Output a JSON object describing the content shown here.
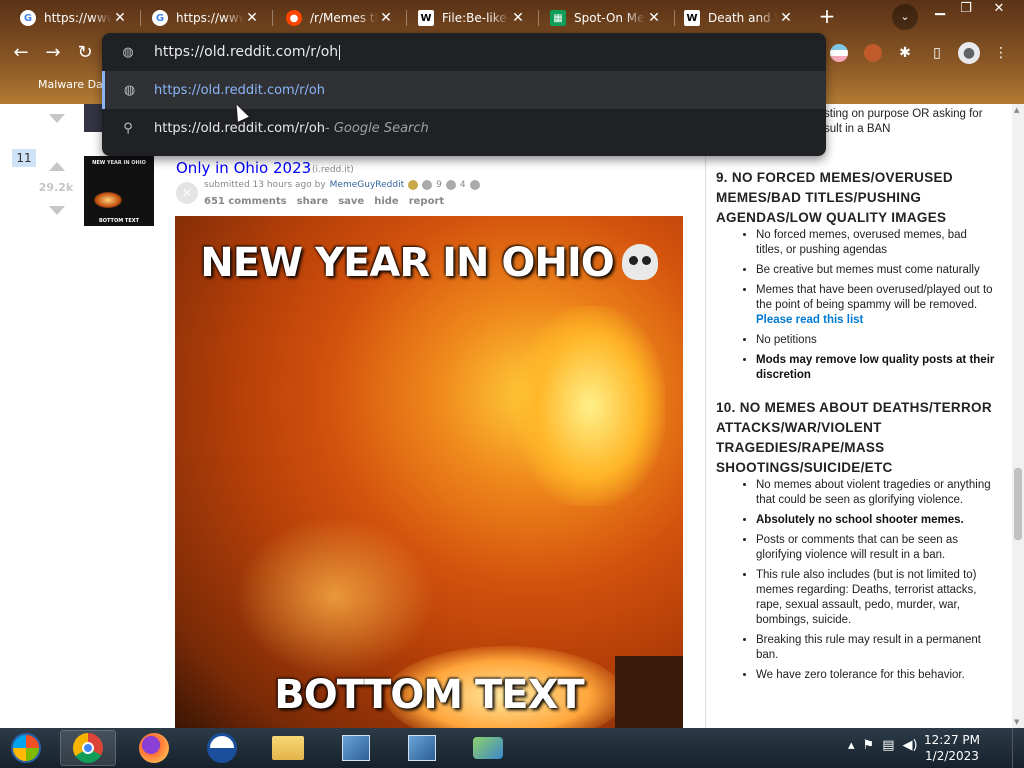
{
  "tabs": [
    {
      "title": "https://www",
      "icon": "google-icon",
      "color": "#4285f4"
    },
    {
      "title": "https://www",
      "icon": "google-icon",
      "color": "#4285f4"
    },
    {
      "title": "/r/Memes th",
      "icon": "reddit-icon",
      "color": "#ff4500"
    },
    {
      "title": "File:Be-like-",
      "icon": "wikipedia-icon",
      "color": "#ffffff"
    },
    {
      "title": "Spot-On Mer",
      "icon": "spreadsheet-icon",
      "color": "#0f9d58"
    },
    {
      "title": "Death and W",
      "icon": "wikipedia-icon",
      "color": "#ffffff"
    }
  ],
  "omnibox": {
    "input": "https://old.reddit.com/r/oh",
    "suggestions": [
      {
        "text": "https://old.reddit.com/r/oh",
        "sub": ""
      },
      {
        "text": "https://old.reddit.com/r/oh",
        "sub": " - Google Search"
      }
    ]
  },
  "bookmarks": {
    "first": "Malware Dat"
  },
  "post": {
    "rank": "11",
    "score": "29.2k",
    "title": "Only in Ohio 2023",
    "domain": "(i.redd.it)",
    "submitted": "submitted 13 hours ago by",
    "author": "MemeGuyReddit",
    "award_count_1": "9",
    "award_count_2": "4",
    "comments": "651 comments",
    "share": "share",
    "save": "save",
    "hide": "hide",
    "report": "report",
    "thumb_top": "NEW YEAR IN OHIO",
    "thumb_bottom": "BOTTOM TEXT",
    "caption_top": "NEW YEAR IN OHIO",
    "caption_bottom": "BOTTOM TEXT"
  },
  "sidebar": {
    "fragment": "sting on purpose OR asking for sult in a BAN",
    "rule9": {
      "heading": "9. NO FORCED MEMES/OVERUSED MEMES/BAD TITLES/PUSHING AGENDAS/LOW QUALITY IMAGES",
      "items": [
        "No forced memes, overused memes, bad titles, or pushing agendas",
        "Be creative but memes must come naturally",
        "Memes that have been overused/played out to the point of being spammy will be removed.",
        "No petitions",
        "Mods may remove low quality posts at their discretion"
      ],
      "link": "Please read this list"
    },
    "rule10": {
      "heading": "10. NO MEMES ABOUT DEATHS/TERROR ATTACKS/WAR/VIOLENT TRAGEDIES/RAPE/MASS SHOOTINGS/SUICIDE/ETC",
      "items": [
        "No memes about violent tragedies or anything that could be seen as glorifying violence.",
        "Absolutely no school shooter memes.",
        "Posts or comments that can be seen as glorifying violence will result in a ban.",
        "This rule also includes (but is not limited to) memes regarding: Deaths, terrorist attacks, rape, sexual assault, pedo, murder, war, bombings, suicide.",
        "Breaking this rule may result in a permanent ban.",
        "We have zero tolerance for this behavior."
      ]
    }
  },
  "taskbar": {
    "time": "12:27 PM",
    "date": "1/2/2023"
  },
  "colors": {
    "accent": "#8ab4f8",
    "link": "#0000ff",
    "rank_bg": "#cee3f8"
  }
}
